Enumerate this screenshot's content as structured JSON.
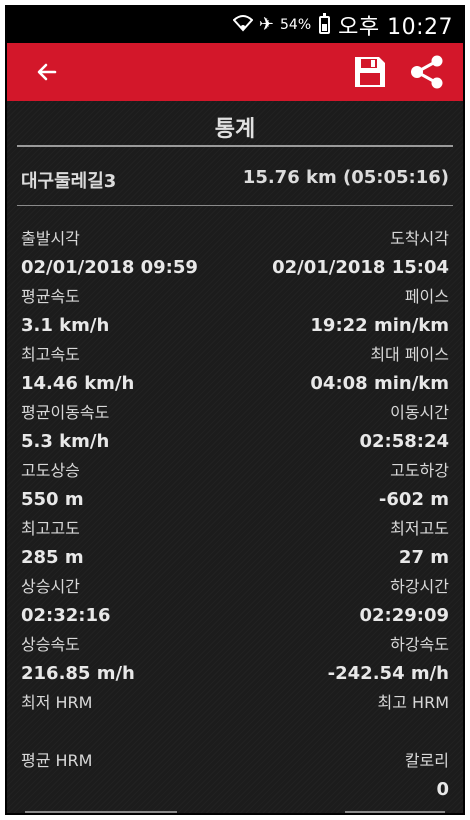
{
  "status_bar": {
    "icons": [
      "wifi-icon",
      "airplane-icon"
    ],
    "battery_percent": "54%",
    "clock": "오후 10:27"
  },
  "app_bar": {
    "back_icon": "arrow-left-icon",
    "save_icon": "floppy-disk-icon",
    "share_icon": "share-icon",
    "accent_color": "#d3172a"
  },
  "section_title": "통계",
  "route": {
    "name": "대구둘레길3",
    "distance_time": "15.76 km (05:05:16)"
  },
  "stats": [
    {
      "left_label": "출발시각",
      "left_value": "02/01/2018 09:59",
      "right_label": "도착시각",
      "right_value": "02/01/2018 15:04"
    },
    {
      "left_label": "평균속도",
      "left_value": "3.1 km/h",
      "right_label": "페이스",
      "right_value": "19:22 min/km"
    },
    {
      "left_label": "최고속도",
      "left_value": "14.46 km/h",
      "right_label": "최대 페이스",
      "right_value": "04:08 min/km"
    },
    {
      "left_label": "평균이동속도",
      "left_value": "5.3 km/h",
      "right_label": "이동시간",
      "right_value": "02:58:24"
    },
    {
      "left_label": "고도상승",
      "left_value": "550 m",
      "right_label": "고도하강",
      "right_value": "-602 m"
    },
    {
      "left_label": "최고고도",
      "left_value": "285 m",
      "right_label": "최저고도",
      "right_value": "27 m"
    },
    {
      "left_label": "상승시간",
      "left_value": "02:32:16",
      "right_label": "하강시간",
      "right_value": "02:29:09"
    },
    {
      "left_label": "상승속도",
      "left_value": "216.85 m/h",
      "right_label": "하강속도",
      "right_value": "-242.54 m/h"
    },
    {
      "left_label": "최저 HRM",
      "left_value": "",
      "right_label": "최고 HRM",
      "right_value": ""
    },
    {
      "left_label": "평균 HRM",
      "left_value": "",
      "right_label": "칼로리",
      "right_value": "0"
    }
  ]
}
